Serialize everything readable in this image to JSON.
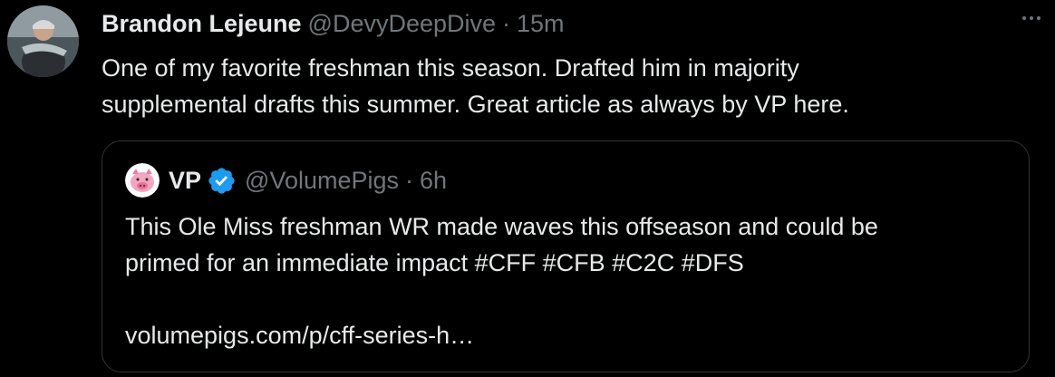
{
  "tweet": {
    "author_name": "Brandon Lejeune",
    "handle": "@DevyDeepDive",
    "separator": "·",
    "time": "15m",
    "more_icon": "more-horizontal-icon",
    "text": "One of my favorite freshman this season. Drafted him in majority\nsupplemental drafts this summer. Great article as always by VP here."
  },
  "quote": {
    "author_name": "VP",
    "verified_icon": "verified-badge-icon",
    "handle": "@VolumePigs",
    "separator": "·",
    "time": "6h",
    "text": "This Ole Miss freshman WR made waves this offseason and could be\nprimed for an immediate impact #CFF #CFB #C2C #DFS\n\nvolumepigs.com/p/cff-series-h…"
  },
  "colors": {
    "background": "#000000",
    "text": "#e7e9ea",
    "secondary_text": "#71767b",
    "border": "#2f3336",
    "verified": "#1d9bf0"
  }
}
